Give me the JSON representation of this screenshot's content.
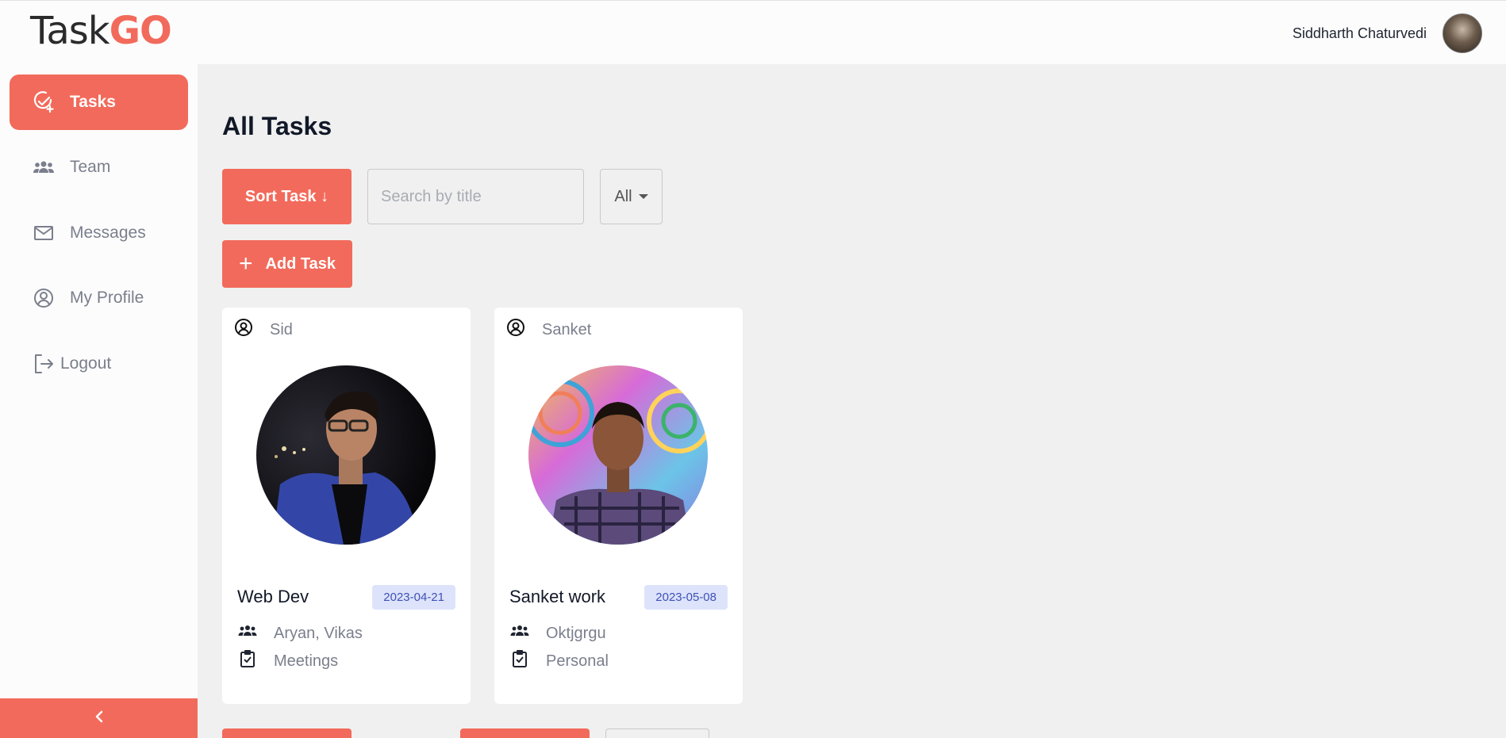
{
  "brand": {
    "logo_main": "Task",
    "logo_accent": "GO"
  },
  "header": {
    "user_name": "Siddharth Chaturvedi"
  },
  "sidebar": {
    "items": [
      {
        "label": "Tasks",
        "icon": "task-check-icon",
        "active": true
      },
      {
        "label": "Team",
        "icon": "team-icon",
        "active": false
      },
      {
        "label": "Messages",
        "icon": "mail-icon",
        "active": false
      },
      {
        "label": "My Profile",
        "icon": "user-circle-icon",
        "active": false
      },
      {
        "label": "Logout",
        "icon": "logout-icon",
        "active": false
      }
    ],
    "collapse_icon": "chevron-left-icon"
  },
  "main": {
    "title": "All Tasks",
    "sort_label": "Sort Task ↓",
    "search_placeholder": "Search by title",
    "filter_value": "All",
    "add_label": "Add Task"
  },
  "tasks": [
    {
      "owner": "Sid",
      "title": "Web Dev",
      "date": "2023-04-21",
      "members": "Aryan, Vikas",
      "category": "Meetings"
    },
    {
      "owner": "Sanket",
      "title": "Sanket work",
      "date": "2023-05-08",
      "members": "Oktjgrgu",
      "category": "Personal"
    }
  ],
  "colors": {
    "accent": "#f26a5b",
    "badge_bg": "#dde3fb",
    "badge_text": "#3f51b5",
    "muted": "#7a7f8c"
  }
}
